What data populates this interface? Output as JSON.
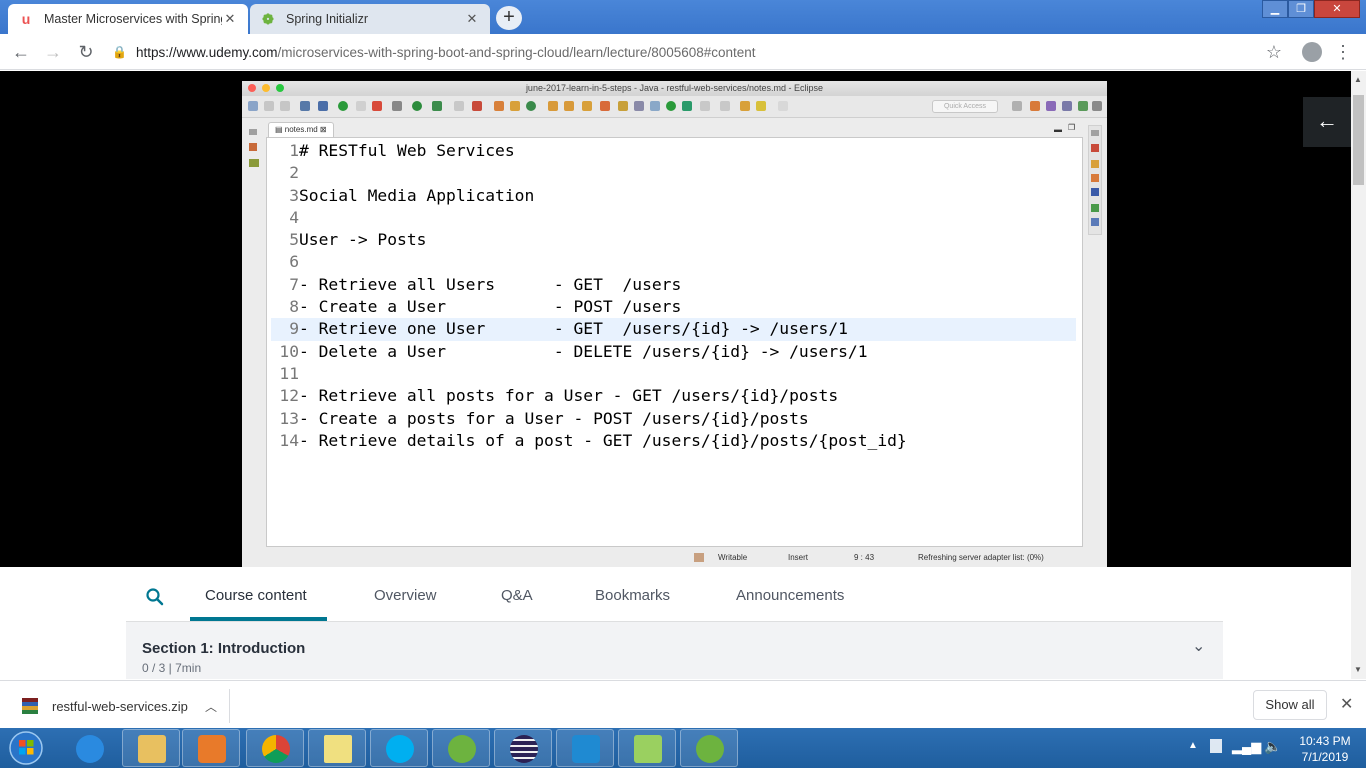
{
  "browser": {
    "tabs": [
      {
        "title": "Master Microservices with Spring",
        "favicon": "udemy-icon",
        "active": true
      },
      {
        "title": "Spring Initializr",
        "favicon": "spring-icon",
        "active": false
      }
    ],
    "url_domain": "https://www.udemy.com",
    "url_path": "/microservices-with-spring-boot-and-spring-cloud/learn/lecture/8005608#content"
  },
  "eclipse": {
    "window_title": "june-2017-learn-in-5-steps - Java - restful-web-services/notes.md - Eclipse",
    "quick_access": "Quick Access",
    "file_tab": "notes.md",
    "lines": [
      {
        "n": "1",
        "text": "# RESTful Web Services"
      },
      {
        "n": "2",
        "text": ""
      },
      {
        "n": "3",
        "text": "Social Media Application"
      },
      {
        "n": "4",
        "text": ""
      },
      {
        "n": "5",
        "text": "User -> Posts"
      },
      {
        "n": "6",
        "text": ""
      },
      {
        "n": "7",
        "text": "- Retrieve all Users      - GET  /users"
      },
      {
        "n": "8",
        "text": "- Create a User           - POST /users"
      },
      {
        "n": "9",
        "text": "- Retrieve one User       - GET  /users/{id} -> /users/1"
      },
      {
        "n": "10",
        "text": "- Delete a User           - DELETE /users/{id} -> /users/1"
      },
      {
        "n": "11",
        "text": ""
      },
      {
        "n": "12",
        "text": "- Retrieve all posts for a User - GET /users/{id}/posts"
      },
      {
        "n": "13",
        "text": "- Create a posts for a User - POST /users/{id}/posts"
      },
      {
        "n": "14",
        "text": "- Retrieve details of a post - GET /users/{id}/posts/{post_id}"
      }
    ],
    "status": {
      "writable": "Writable",
      "insert": "Insert",
      "position": "9 : 43",
      "progress": "Refreshing server adapter list: (0%)"
    }
  },
  "course": {
    "tabs": [
      "Course content",
      "Overview",
      "Q&A",
      "Bookmarks",
      "Announcements"
    ],
    "active_tab": "Course content",
    "section_title": "Section 1: Introduction",
    "section_meta": "0 / 3 | 7min"
  },
  "downloads": {
    "file": "restful-web-services.zip",
    "show_all": "Show all"
  },
  "taskbar": {
    "time": "10:43 PM",
    "date": "7/1/2019"
  },
  "colors": {
    "accent": "#007791",
    "chrome_frame": "#3a76cc",
    "current_line": "#e8f2fe"
  }
}
